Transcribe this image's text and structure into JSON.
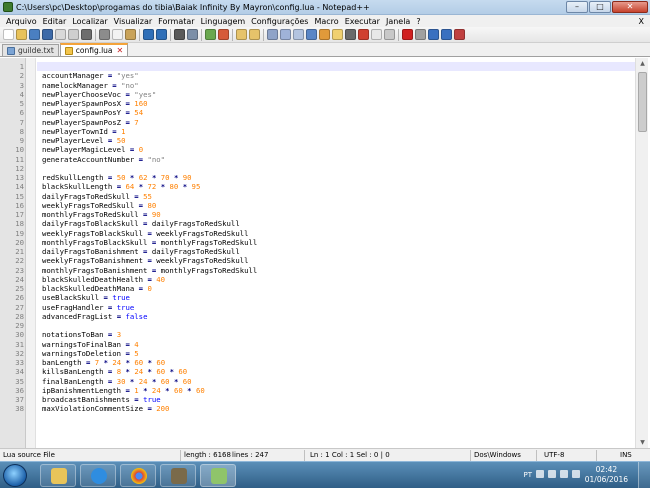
{
  "window": {
    "title": "C:\\Users\\pc\\Desktop\\progamas do tibia\\Baiak Infinity By Mayron\\config.lua - Notepad++",
    "minimize": "–",
    "maximize": "□",
    "close": "✕"
  },
  "menu": {
    "items": [
      "Arquivo",
      "Editar",
      "Localizar",
      "Visualizar",
      "Formatar",
      "Linguagem",
      "Configurações",
      "Macro",
      "Executar",
      "Janela",
      "?"
    ],
    "close_glyph": "X"
  },
  "tabs": [
    {
      "label": "guilde.txt",
      "close": "✕",
      "active": false
    },
    {
      "label": "config.lua",
      "close": "✕",
      "active": true
    }
  ],
  "editor": {
    "lines": [
      {
        "n": "1",
        "t": ""
      },
      {
        "n": "2",
        "t": "accountManager = \"yes\""
      },
      {
        "n": "3",
        "t": "namelockManager = \"no\""
      },
      {
        "n": "4",
        "t": "newPlayerChooseVoc = \"yes\""
      },
      {
        "n": "5",
        "t": "newPlayerSpawnPosX = 160"
      },
      {
        "n": "6",
        "t": "newPlayerSpawnPosY = 54"
      },
      {
        "n": "7",
        "t": "newPlayerSpawnPosZ = 7"
      },
      {
        "n": "8",
        "t": "newPlayerTownId = 1"
      },
      {
        "n": "9",
        "t": "newPlayerLevel = 50"
      },
      {
        "n": "10",
        "t": "newPlayerMagicLevel = 0"
      },
      {
        "n": "11",
        "t": "generateAccountNumber = \"no\""
      },
      {
        "n": "12",
        "t": ""
      },
      {
        "n": "13",
        "t": "redSkullLength = 50 * 62 * 70 * 90"
      },
      {
        "n": "14",
        "t": "blackSkullLength = 64 * 72 * 80 * 95"
      },
      {
        "n": "15",
        "t": "dailyFragsToRedSkull = 55"
      },
      {
        "n": "16",
        "t": "weeklyFragsToRedSkull = 80"
      },
      {
        "n": "17",
        "t": "monthlyFragsToRedSkull = 90"
      },
      {
        "n": "18",
        "t": "dailyFragsToBlackSkull = dailyFragsToRedSkull"
      },
      {
        "n": "19",
        "t": "weeklyFragsToBlackSkull = weeklyFragsToRedSkull"
      },
      {
        "n": "20",
        "t": "monthlyFragsToBlackSkull = monthlyFragsToRedSkull"
      },
      {
        "n": "21",
        "t": "dailyFragsToBanishment = dailyFragsToRedSkull"
      },
      {
        "n": "22",
        "t": "weeklyFragsToBanishment = weeklyFragsToRedSkull"
      },
      {
        "n": "23",
        "t": "monthlyFragsToBanishment = monthlyFragsToRedSkull"
      },
      {
        "n": "24",
        "t": "blackSkulledDeathHealth = 40"
      },
      {
        "n": "25",
        "t": "blackSkulledDeathMana = 0"
      },
      {
        "n": "26",
        "t": "useBlackSkull = true"
      },
      {
        "n": "27",
        "t": "useFragHandler = true"
      },
      {
        "n": "28",
        "t": "advancedFragList = false"
      },
      {
        "n": "29",
        "t": ""
      },
      {
        "n": "30",
        "t": "notationsToBan = 3"
      },
      {
        "n": "31",
        "t": "warningsToFinalBan = 4"
      },
      {
        "n": "32",
        "t": "warningsToDeletion = 5"
      },
      {
        "n": "33",
        "t": "banLength = 7 * 24 * 60 * 60"
      },
      {
        "n": "34",
        "t": "killsBanLength = 8 * 24 * 60 * 60"
      },
      {
        "n": "35",
        "t": "finalBanLength = 30 * 24 * 60 * 60"
      },
      {
        "n": "36",
        "t": "ipBanishmentLength = 1 * 24 * 60 * 60"
      },
      {
        "n": "37",
        "t": "broadcastBanishments = true"
      },
      {
        "n": "38",
        "t": "maxViolationCommentSize = 200"
      }
    ]
  },
  "status": {
    "file_type": "Lua source File",
    "length": "length : 6168",
    "lines": "lines : 247",
    "position": "Ln : 1   Col : 1   Sel : 0 | 0",
    "eol": "Dos\\Windows",
    "encoding": "UTF-8",
    "mode": "INS"
  },
  "taskbar": {
    "lang": "PT",
    "time": "02:42",
    "date": "01/06/2016"
  }
}
